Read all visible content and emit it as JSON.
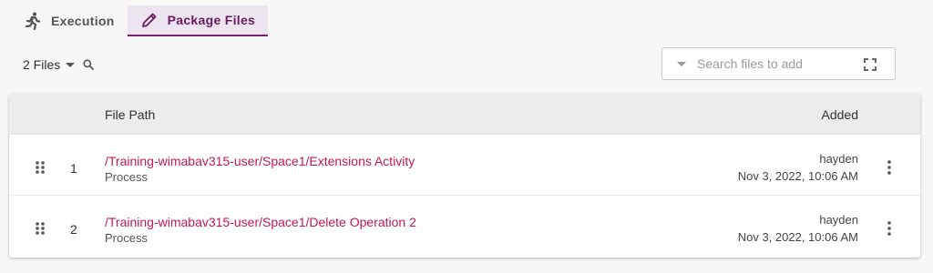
{
  "tabs": [
    {
      "label": "Execution",
      "icon": "running-person-icon"
    },
    {
      "label": "Package Files",
      "icon": "pencil-icon",
      "active": true
    }
  ],
  "files": {
    "count_label": "2 Files"
  },
  "search": {
    "placeholder": "Search files to add"
  },
  "table": {
    "headers": {
      "path": "File Path",
      "added": "Added"
    },
    "rows": [
      {
        "num": "1",
        "path": "/Training-wimabav315-user/Space1/Extensions Activity",
        "type": "Process",
        "user": "hayden",
        "date": "Nov 3, 2022, 10:06 AM"
      },
      {
        "num": "2",
        "path": "/Training-wimabav315-user/Space1/Delete Operation 2",
        "type": "Process",
        "user": "hayden",
        "date": "Nov 3, 2022, 10:06 AM"
      }
    ]
  },
  "colors": {
    "accent": "#7b1f6e",
    "link": "#c2185b",
    "tab_active_bg": "#ece4ef"
  }
}
